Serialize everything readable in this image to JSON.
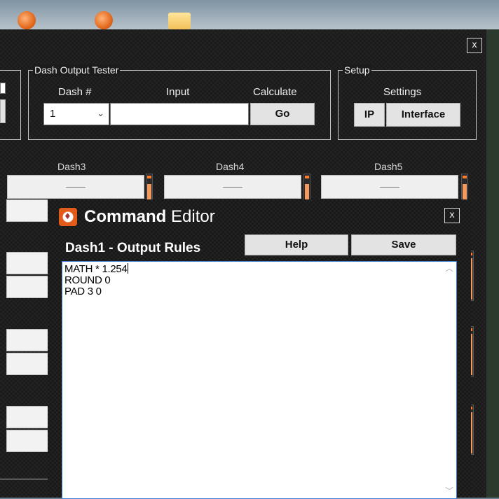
{
  "main_window": {
    "close_label": "x",
    "tester": {
      "title": "Dash Output Tester",
      "dash_label": "Dash #",
      "input_label": "Input",
      "calculate_label": "Calculate",
      "dash_value": "1",
      "input_value": "",
      "go_label": "Go"
    },
    "setup": {
      "title": "Setup",
      "settings_label": "Settings",
      "ip_label": "IP",
      "interface_label": "Interface"
    },
    "dashes": [
      {
        "label": "Dash3",
        "value": "——"
      },
      {
        "label": "Dash4",
        "value": "——"
      },
      {
        "label": "Dash5",
        "value": "——"
      }
    ]
  },
  "editor": {
    "title_bold": "Command",
    "title_rest": " Editor",
    "close_label": "x",
    "rules_title": "Dash1 - Output Rules",
    "help_label": "Help",
    "save_label": "Save",
    "lines": [
      "MATH * 1.254",
      "ROUND 0",
      "PAD 3 0"
    ]
  },
  "icons": [
    "app-icon",
    "folder-icon",
    "command-editor-icon",
    "chevron-down-icon",
    "scroll-up-icon",
    "scroll-down-icon"
  ]
}
